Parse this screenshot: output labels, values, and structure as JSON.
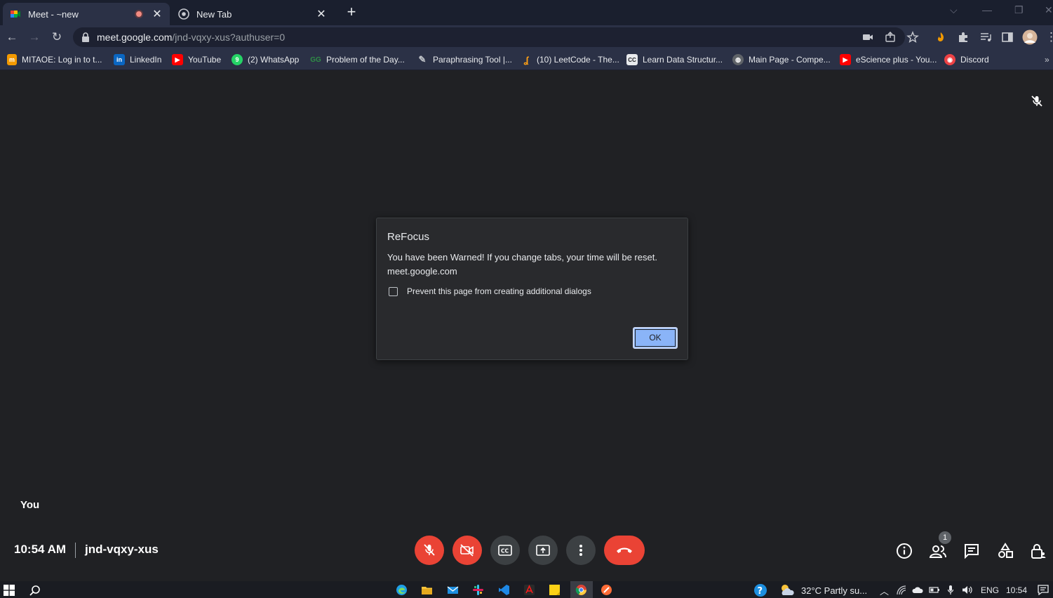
{
  "browser": {
    "tabs": [
      {
        "title": "Meet - ~new",
        "favicon": "google-meet-icon",
        "recording": true
      },
      {
        "title": "New Tab",
        "favicon": "chrome-icon",
        "recording": false
      }
    ],
    "new_tab_label": "+",
    "url_host": "meet.google.com",
    "url_path": "/jnd-vqxy-xus?authuser=0",
    "bookmarks": [
      {
        "label": "MITAOE: Log in to t...",
        "icon": "mitaoe-icon",
        "color": "#f29900"
      },
      {
        "label": "LinkedIn",
        "icon": "linkedin-icon",
        "color": "#0a66c2"
      },
      {
        "label": "YouTube",
        "icon": "youtube-icon",
        "color": "#ff0000"
      },
      {
        "label": "(2) WhatsApp",
        "icon": "whatsapp-icon",
        "color": "#25d366"
      },
      {
        "label": "Problem of the Day...",
        "icon": "geeksforgeeks-icon",
        "color": "#2f8d46"
      },
      {
        "label": "Paraphrasing Tool |...",
        "icon": "quill-icon",
        "color": "#bdc1c6"
      },
      {
        "label": "(10) LeetCode - The...",
        "icon": "leetcode-icon",
        "color": "#ffa116"
      },
      {
        "label": "Learn Data Structur...",
        "icon": "codechef-icon",
        "color": "#e8eaed"
      },
      {
        "label": "Main Page - Compe...",
        "icon": "wiki-icon",
        "color": "#9aa0a6"
      },
      {
        "label": "eScience plus - You...",
        "icon": "youtube-icon",
        "color": "#ff0000"
      },
      {
        "label": "Discord",
        "icon": "discord-icon",
        "color": "#ed4245"
      }
    ]
  },
  "meet": {
    "you_label": "You",
    "time": "10:54 AM",
    "meeting_code": "jnd-vqxy-xus",
    "participants_count": "1",
    "accent_red": "#ea4335"
  },
  "dialog": {
    "title": "ReFocus",
    "message": "You have been Warned! If you change tabs, your time will be reset.",
    "origin": "meet.google.com",
    "checkbox_label": "Prevent this page from creating additional dialogs",
    "ok_label": "OK"
  },
  "taskbar": {
    "weather": "32°C  Partly su...",
    "language": "ENG",
    "clock": "10:54"
  }
}
